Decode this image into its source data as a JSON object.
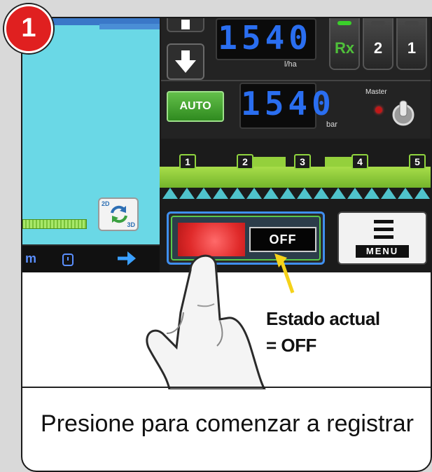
{
  "step": {
    "number": "1"
  },
  "screen": {
    "rate": {
      "value": "1540",
      "unit": "l/ha"
    },
    "pressure": {
      "value": "1540",
      "unit": "bar"
    },
    "presets": [
      "Rx",
      "2",
      "1"
    ],
    "auto_label": "AUTO",
    "master_label": "Master",
    "view_toggle": {
      "label_2d": "2D",
      "label_3d": "3D"
    },
    "map_units": "m",
    "sections": [
      "1",
      "2",
      "3",
      "4",
      "5"
    ],
    "record_state": "OFF",
    "menu_label": "MENU"
  },
  "annotation": {
    "line1": "Estado actual",
    "line2": "= OFF"
  },
  "caption": "Presione para comenzar a registrar",
  "colors": {
    "badge": "#e02020",
    "lcd": "#2a6ef0",
    "boom": "#94d03c",
    "record": "#e02a2a"
  }
}
